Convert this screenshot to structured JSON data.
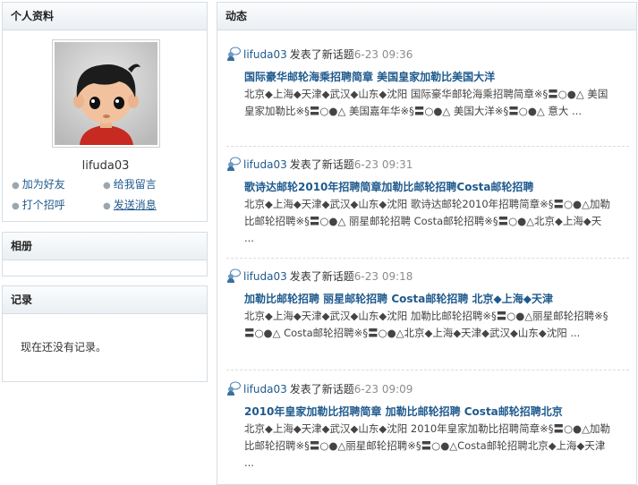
{
  "profile": {
    "title": "个人资料",
    "username": "lifuda03",
    "actions": {
      "add_friend": "加为好友",
      "leave_message": "给我留言",
      "greet": "打个招呼",
      "send_message": "发送消息"
    }
  },
  "album": {
    "title": "相册"
  },
  "records": {
    "title": "记录",
    "empty_text": "现在还没有记录。"
  },
  "feed": {
    "title": "动态",
    "items": [
      {
        "user": "lifuda03",
        "action": "发表了新话题",
        "time": "6-23 09:36",
        "title": "国际豪华邮轮海乘招聘简章 美国皇家加勒比美国大洋",
        "body": "北京◆上海◆天津◆武汉◆山东◆沈阳 国际豪华邮轮海乘招聘简章※§〓○●△ 美国皇家加勒比※§〓○●△ 美国嘉年华※§〓○●△ 美国大洋※§〓○●△ 意大 ..."
      },
      {
        "user": "lifuda03",
        "action": "发表了新话题",
        "time": "6-23 09:31",
        "title": "歌诗达邮轮2010年招聘简章加勒比邮轮招聘Costa邮轮招聘",
        "body": "北京◆上海◆天津◆武汉◆山东◆沈阳 歌诗达邮轮2010年招聘简章※§〓○●△加勒比邮轮招聘※§〓○●△ 丽星邮轮招聘 Costa邮轮招聘※§〓○●△北京◆上海◆天 ..."
      },
      {
        "user": "lifuda03",
        "action": "发表了新话题",
        "time": "6-23 09:18",
        "title": "加勒比邮轮招聘 丽星邮轮招聘 Costa邮轮招聘 北京◆上海◆天津",
        "body": "北京◆上海◆天津◆武汉◆山东◆沈阳 加勒比邮轮招聘※§〓○●△丽星邮轮招聘※§〓○●△ Costa邮轮招聘※§〓○●△北京◆上海◆天津◆武汉◆山东◆沈阳 ..."
      },
      {
        "user": "lifuda03",
        "action": "发表了新话题",
        "time": "6-23 09:09",
        "title": "2010年皇家加勒比招聘简章 加勒比邮轮招聘 Costa邮轮招聘北京",
        "body": "北京◆上海◆天津◆武汉◆山东◆沈阳 2010年皇家加勒比招聘简章※§〓○●△加勒比邮轮招聘※§〓○●△丽星邮轮招聘※§〓○●△Costa邮轮招聘北京◆上海◆天津 ..."
      }
    ]
  }
}
